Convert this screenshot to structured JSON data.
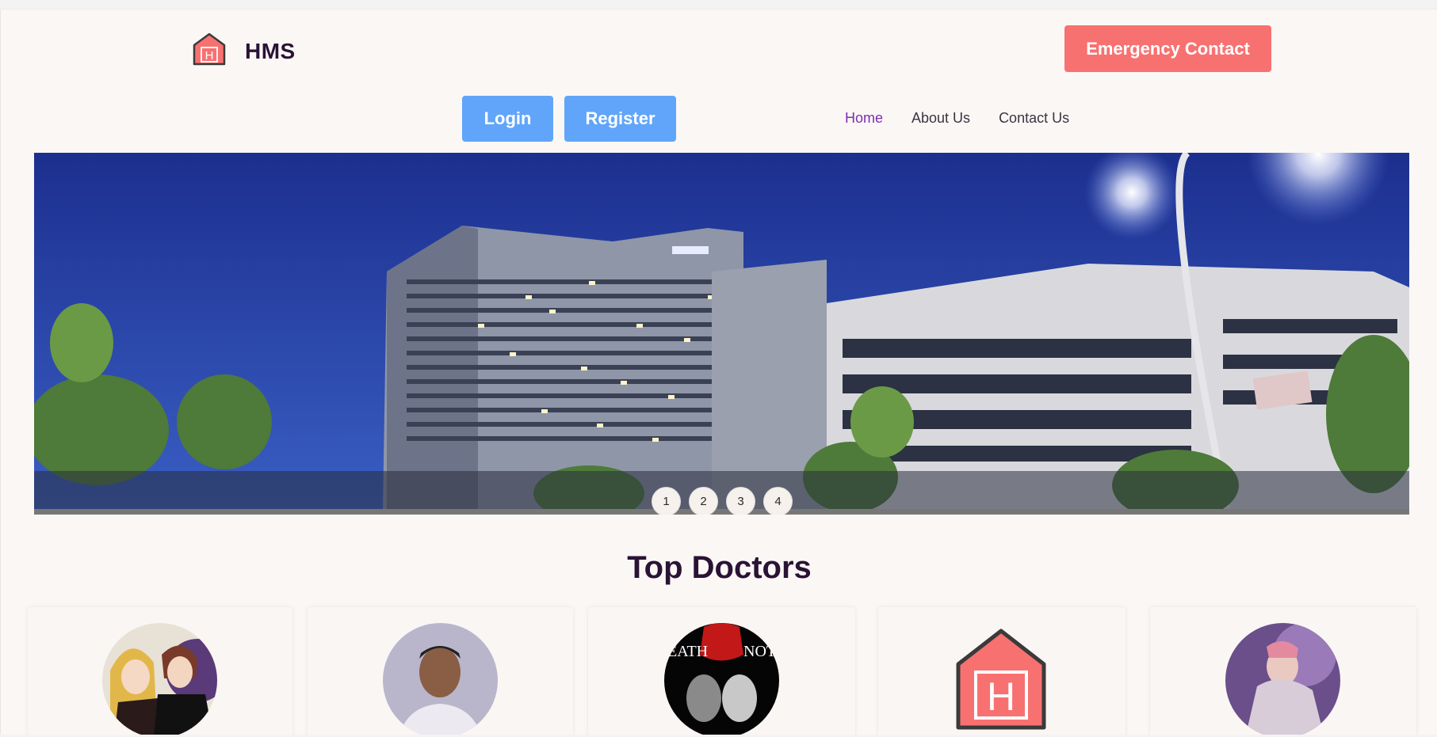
{
  "brand": {
    "name": "HMS",
    "logo_icon": "hospital-house-icon",
    "accent": "#f87171"
  },
  "header": {
    "emergency_label": "Emergency Contact",
    "login_label": "Login",
    "register_label": "Register",
    "nav": [
      {
        "label": "Home",
        "active": true
      },
      {
        "label": "About Us",
        "active": false
      },
      {
        "label": "Contact Us",
        "active": false
      }
    ]
  },
  "hero": {
    "image": "hospital-building-night-photo",
    "slides": [
      "1",
      "2",
      "3",
      "4"
    ]
  },
  "doctors": {
    "title": "Top Doctors",
    "cards": [
      {
        "avatar": "anime-couple-avatar"
      },
      {
        "avatar": "man-portrait-avatar"
      },
      {
        "avatar": "death-note-avatar"
      },
      {
        "avatar": "hospital-logo-avatar"
      },
      {
        "avatar": "anime-character-avatar"
      }
    ]
  }
}
